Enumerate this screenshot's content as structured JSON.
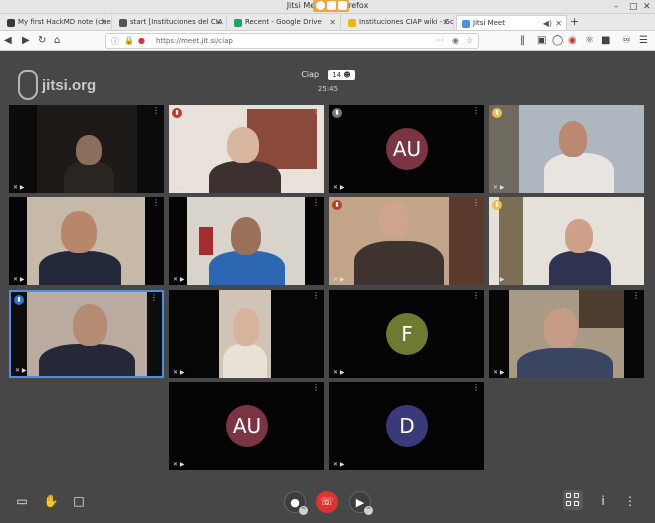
{
  "window": {
    "title": "Jitsi Meet — Mozilla Firefox",
    "title_visible": "Jitsi Mee",
    "title_tail": "refox"
  },
  "tabs": [
    {
      "label": "My first HackMD note (che",
      "color": "#3a3a3a"
    },
    {
      "label": "start [Instituciones del CIA",
      "color": "#555555"
    },
    {
      "label": "Recent - Google Drive",
      "color": "#1fa463"
    },
    {
      "label": "Instituciones CIAP wiki - Go",
      "color": "#f4b400"
    },
    {
      "label": "Jitsi Meet",
      "color": "#4a90e2"
    }
  ],
  "navbar": {
    "url": "https://meet.jit.si/ciap",
    "more": "···"
  },
  "branding": {
    "logo_text": "jitsi.org"
  },
  "room": {
    "name": "Ciap",
    "participant_count": "14",
    "timer": "25:45"
  },
  "participants": [
    {
      "kind": "video",
      "row": 0,
      "col": 0
    },
    {
      "kind": "video",
      "row": 0,
      "col": 1,
      "indicator": "red"
    },
    {
      "kind": "avatar",
      "row": 0,
      "col": 2,
      "initials": "AU",
      "color": "#7a3442",
      "indicator": "grey"
    },
    {
      "kind": "video",
      "row": 0,
      "col": 3,
      "indicator": "yellow"
    },
    {
      "kind": "video",
      "row": 1,
      "col": 0
    },
    {
      "kind": "video",
      "row": 1,
      "col": 1
    },
    {
      "kind": "video",
      "row": 1,
      "col": 2,
      "indicator": "red"
    },
    {
      "kind": "video",
      "row": 1,
      "col": 3,
      "indicator": "yellow"
    },
    {
      "kind": "video",
      "row": 2,
      "col": 0,
      "indicator": "blue",
      "active": true
    },
    {
      "kind": "video",
      "row": 2,
      "col": 1
    },
    {
      "kind": "avatar",
      "row": 2,
      "col": 2,
      "initials": "F",
      "color": "#6e7a30"
    },
    {
      "kind": "video",
      "row": 2,
      "col": 3
    },
    {
      "kind": "avatar",
      "row": 3,
      "col": 1,
      "initials": "AU",
      "color": "#7a3442"
    },
    {
      "kind": "avatar",
      "row": 3,
      "col": 2,
      "initials": "D",
      "color": "#3a3a7a"
    }
  ],
  "tile_menu": "⋮",
  "toolbar": {
    "screen_share": "screen-share",
    "raise_hand": "raise-hand",
    "chat": "chat",
    "mic": "mic-muted",
    "hangup": "hangup",
    "camera": "camera-muted",
    "tile_view": "tile-view",
    "info": "i",
    "more": "⋮"
  },
  "colors": {
    "background": "#474747",
    "hangup": "#e0322f",
    "active_border": "#4a90e2"
  }
}
